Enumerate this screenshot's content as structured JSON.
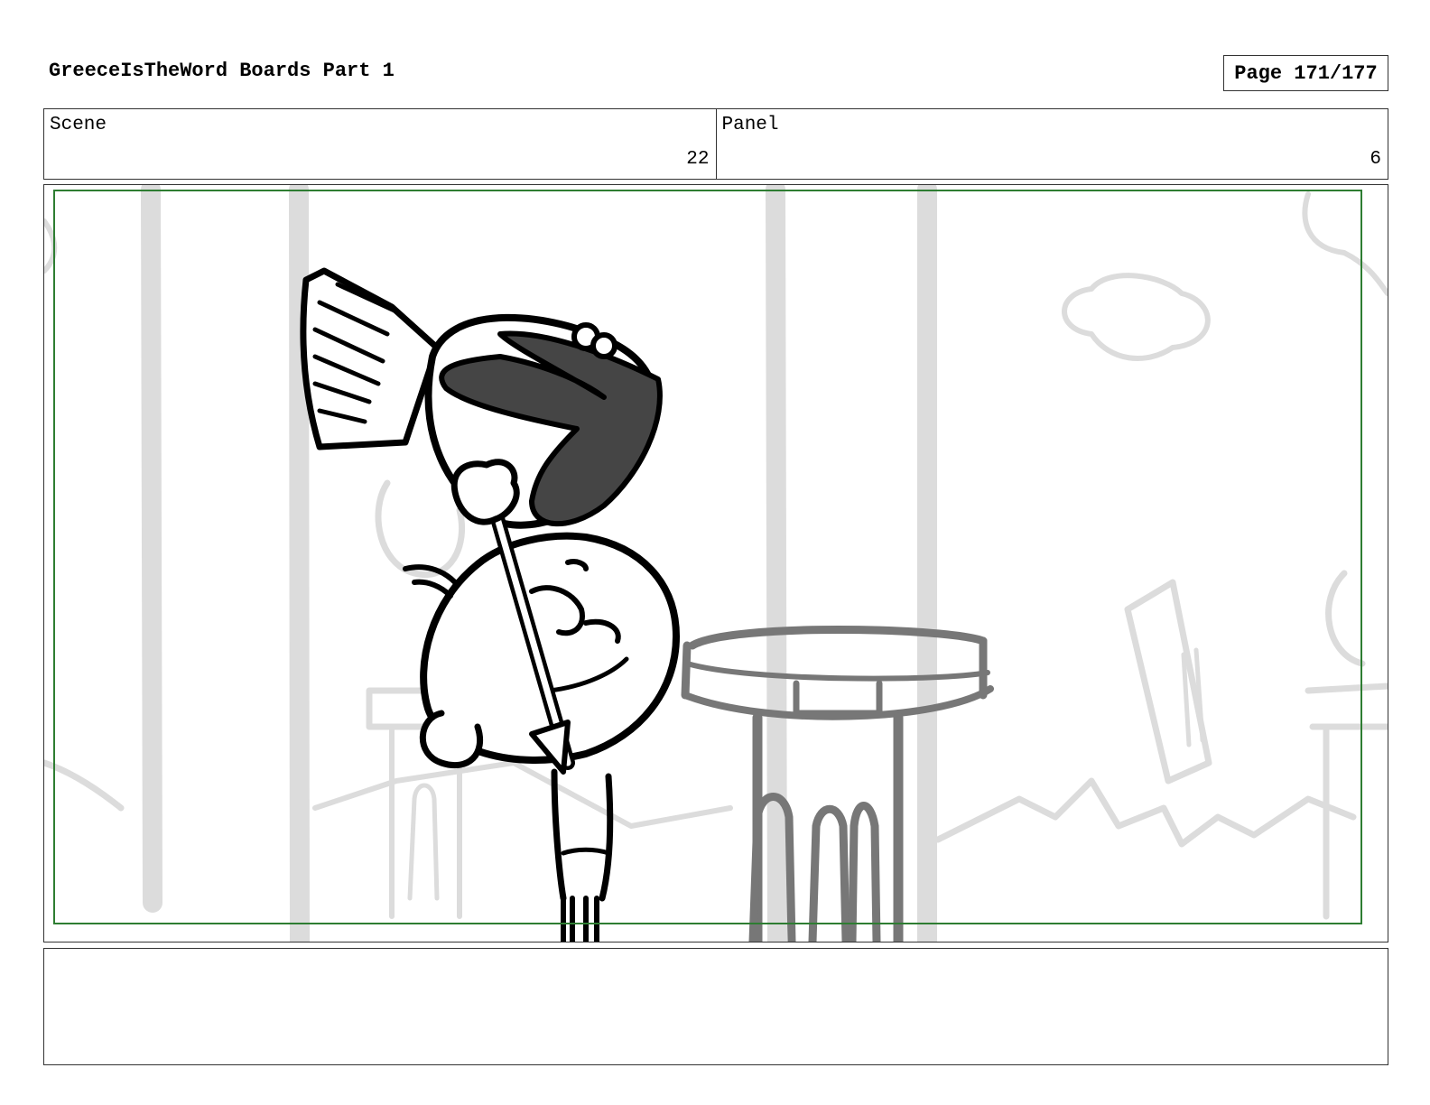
{
  "header": {
    "title": "GreeceIsTheWord Boards Part 1",
    "page_label": "Page 171/177"
  },
  "info": {
    "scene_label": "Scene",
    "scene_value": "22",
    "panel_label": "Panel",
    "panel_value": "6"
  },
  "colors": {
    "safe_frame": "#2e7d32",
    "background_lines": "#dcdcdc",
    "pedestal": "#777777",
    "helmet_fill": "#454545",
    "ink": "#000000"
  },
  "notes": {
    "text": ""
  }
}
